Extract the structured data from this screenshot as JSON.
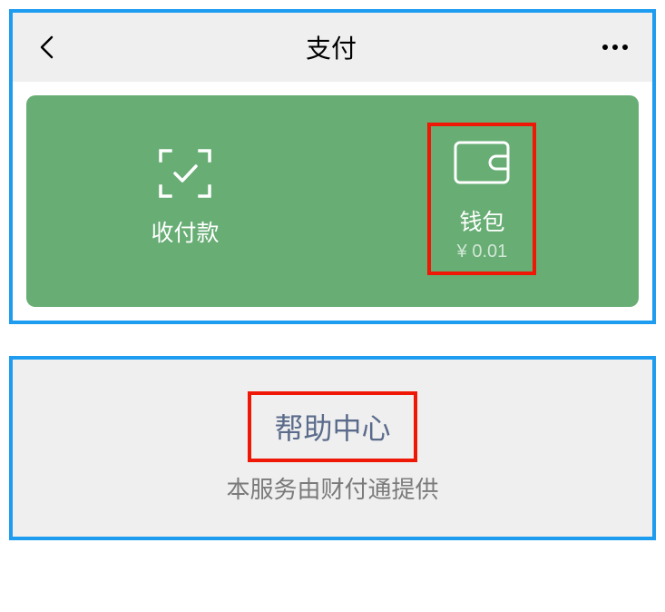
{
  "header": {
    "title": "支付"
  },
  "card": {
    "payReceive": {
      "label": "收付款"
    },
    "wallet": {
      "label": "钱包",
      "balance": "¥ 0.01"
    }
  },
  "footer": {
    "helpCenter": "帮助中心",
    "provider": "本服务由财付通提供"
  },
  "colors": {
    "highlightBlue": "#1e9cf0",
    "highlightRed": "#ef1806",
    "cardGreen": "#67ad74",
    "helpText": "#5b6b8b"
  }
}
